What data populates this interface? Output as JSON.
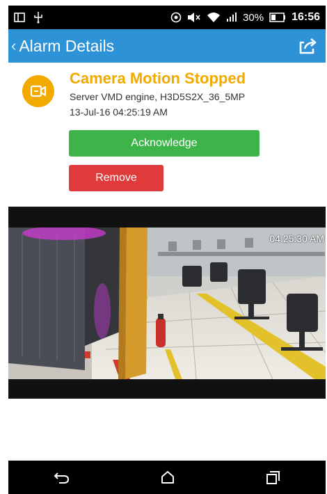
{
  "status_bar": {
    "battery_percent": "30%",
    "time": "16:56",
    "icons": [
      "screen-mirror-icon",
      "usb-icon",
      "alarm-clock-icon",
      "mute-icon",
      "wifi-icon",
      "signal-icon",
      "battery-icon"
    ]
  },
  "app_bar": {
    "title": "Alarm Details",
    "back_icon": "chevron-left-icon",
    "share_icon": "share-icon"
  },
  "alarm": {
    "icon": "camera-icon",
    "title": "Camera Motion Stopped",
    "source": "Server VMD engine, H3D5S2X_36_5MP",
    "datetime": "13-Jul-16 04:25:19 AM"
  },
  "actions": {
    "acknowledge_label": "Acknowledge",
    "remove_label": "Remove"
  },
  "video": {
    "timestamp": "04:25:30 AM"
  },
  "nav_bar": {
    "icons": [
      "back-icon",
      "home-icon",
      "recent-apps-icon"
    ]
  },
  "colors": {
    "app_bar": "#2e93d6",
    "alarm_accent": "#f2a900",
    "acknowledge": "#3cb44a",
    "remove": "#e03b3b"
  }
}
